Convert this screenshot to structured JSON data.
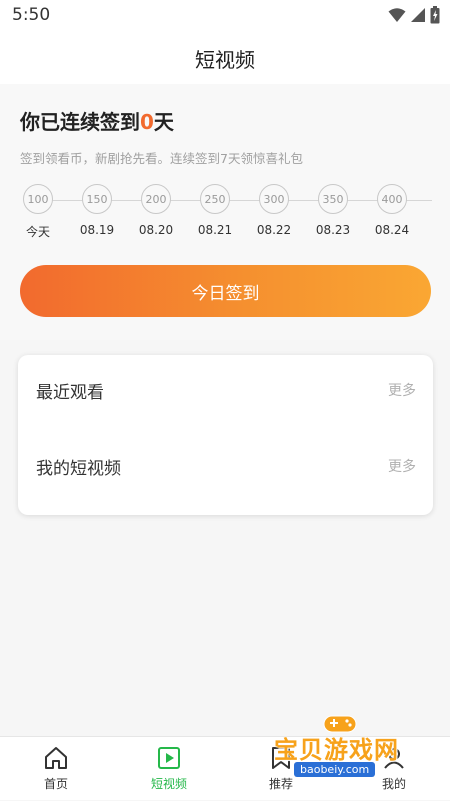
{
  "status_bar": {
    "time": "5:50"
  },
  "header": {
    "title": "短视频"
  },
  "checkin": {
    "heading_prefix": "你已连续签到",
    "day_count": "0",
    "heading_suffix": "天",
    "subtext": "签到领看币，新剧抢先看。连续签到7天领惊喜礼包",
    "days": [
      {
        "points": "100",
        "label": "今天"
      },
      {
        "points": "150",
        "label": "08.19"
      },
      {
        "points": "200",
        "label": "08.20"
      },
      {
        "points": "250",
        "label": "08.21"
      },
      {
        "points": "300",
        "label": "08.22"
      },
      {
        "points": "350",
        "label": "08.23"
      },
      {
        "points": "400",
        "label": "08.24"
      }
    ],
    "button_label": "今日签到",
    "accent_color": "#f26a2e"
  },
  "lists": [
    {
      "title": "最近观看",
      "more": "更多"
    },
    {
      "title": "我的短视频",
      "more": "更多"
    }
  ],
  "bottom_nav": {
    "active_color": "#25b84a",
    "items": [
      {
        "label": "首页",
        "icon": "home-icon"
      },
      {
        "label": "短视频",
        "icon": "play-square-icon"
      },
      {
        "label": "推荐",
        "icon": "bookmark-icon"
      },
      {
        "label": "我的",
        "icon": "user-icon"
      }
    ]
  },
  "watermark": {
    "title": "宝贝游戏网",
    "url": "baobeiy.com"
  }
}
